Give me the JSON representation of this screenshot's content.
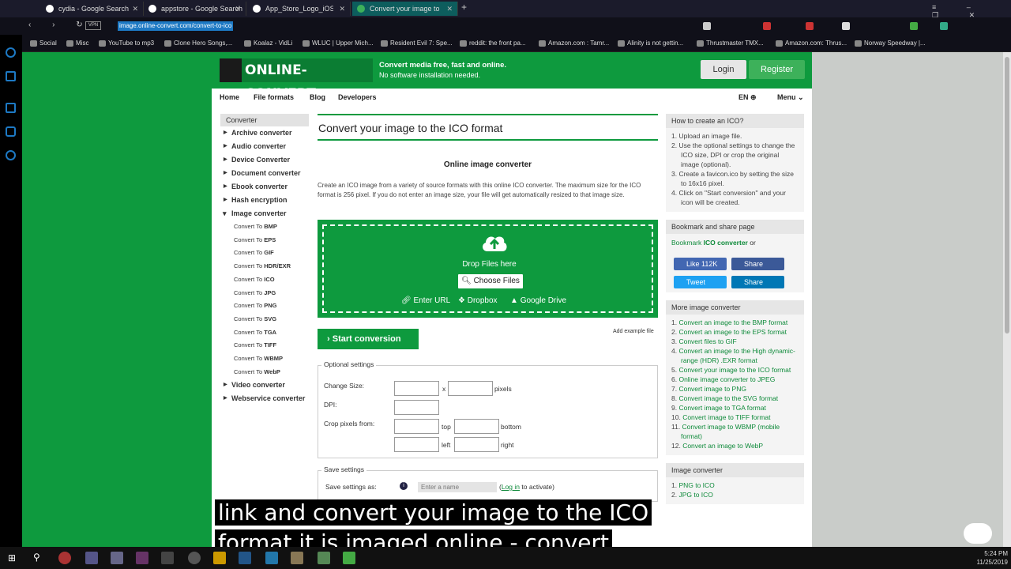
{
  "browser": {
    "tabs": [
      {
        "label": "cydia - Google Search"
      },
      {
        "label": "appstore - Google Search"
      },
      {
        "label": "App_Store_Logo_iOS_7-e1"
      },
      {
        "label": "Convert your image to ICO"
      }
    ],
    "url": "image.online-convert.com/convert-to-ico",
    "bookmarks": [
      "Social",
      "Misc",
      "YouTube to mp3",
      "Clone Hero Songs,...",
      "Koalaz - VidLi",
      "WLUC | Upper Mich...",
      "Resident Evil 7: Spe...",
      "reddit: the front pa...",
      "Amazon.com : Tamr...",
      "Alinity is not gettin...",
      "Thrustmaster TMX...",
      "Amazon.com: Thrus...",
      "Norway Speedway |..."
    ]
  },
  "header": {
    "logo": "ONLINE-CONVERT",
    "tagline_bold": "Convert media free, fast and online.",
    "tagline": "No software installation needed.",
    "login": "Login",
    "register": "Register"
  },
  "nav": {
    "home": "Home",
    "file_formats": "File formats",
    "blog": "Blog",
    "developers": "Developers",
    "lang": "EN",
    "menu": "Menu"
  },
  "sidebar": {
    "heading": "Converter",
    "items": [
      "Archive converter",
      "Audio converter",
      "Device Converter",
      "Document converter",
      "Ebook converter",
      "Hash encryption"
    ],
    "open_item": "Image converter",
    "sub_prefix": "Convert To",
    "subitems": [
      "BMP",
      "EPS",
      "GIF",
      "HDR/EXR",
      "ICO",
      "JPG",
      "PNG",
      "SVG",
      "TGA",
      "TIFF",
      "WBMP",
      "WebP"
    ],
    "items_after": [
      "Video converter",
      "Webservice converter"
    ]
  },
  "main": {
    "title": "Convert your image to the ICO format",
    "subtitle": "Online image converter",
    "description": "Create an ICO image from a variety of source formats with this online ICO converter. The maximum size for the ICO format is 256 pixel. If you do not enter an image size, your file will get automatically resized to that image size.",
    "drop_text": "Drop Files here",
    "choose": "Choose Files",
    "enter_url": "Enter URL",
    "dropbox": "Dropbox",
    "gdrive": "Google Drive",
    "start": "Start conversion",
    "add_example": "Add example file",
    "optional_legend": "Optional settings",
    "change_size": "Change Size:",
    "x": "x",
    "pixels": "pixels",
    "dpi": "DPI:",
    "crop": "Crop pixels from:",
    "top": "top",
    "bottom": "bottom",
    "left": "left",
    "right": "right",
    "save_legend": "Save settings",
    "save_as": "Save settings as:",
    "name_placeholder": "Enter a name",
    "login_link": "Log in",
    "to_activate": "to activate)"
  },
  "right": {
    "howto_title": "How to create an ICO?",
    "howto_steps": [
      "Upload an image file.",
      "Use the optional settings to change the ICO size, DPI or crop the original image (optional).",
      "Create a favicon.ico by setting the size to 16x16 pixel.",
      "Click on \"Start conversion\" and your icon will be created."
    ],
    "bookmark_title": "Bookmark and share page",
    "bookmark_pre": "Bookmark",
    "bookmark_bold": "ICO converter",
    "bookmark_post": "or",
    "like": "Like 112K",
    "share": "Share",
    "tweet": "Tweet",
    "share2": "Share",
    "more_title": "More image converter",
    "more_links": [
      "Convert an image to the BMP format",
      "Convert an image to the EPS format",
      "Convert files to GIF",
      "Convert an image to the High dynamic-range (HDR) .EXR format",
      "Convert your image to the ICO format",
      "Online image converter to JPEG",
      "Convert image to PNG",
      "Convert image to the SVG format",
      "Convert image to TGA format",
      "Convert image to TIFF format",
      "Convert image to WBMP (mobile format)",
      "Convert an image to WebP"
    ],
    "imgconv_title": "Image converter",
    "imgconv_links": [
      "PNG to ICO",
      "JPG to ICO"
    ]
  },
  "caption": {
    "line1": "link and convert your image to the ICO",
    "line2": "format it is imaged online - convert"
  },
  "taskbar": {
    "time": "5:24 PM",
    "date": "11/25/2019"
  }
}
